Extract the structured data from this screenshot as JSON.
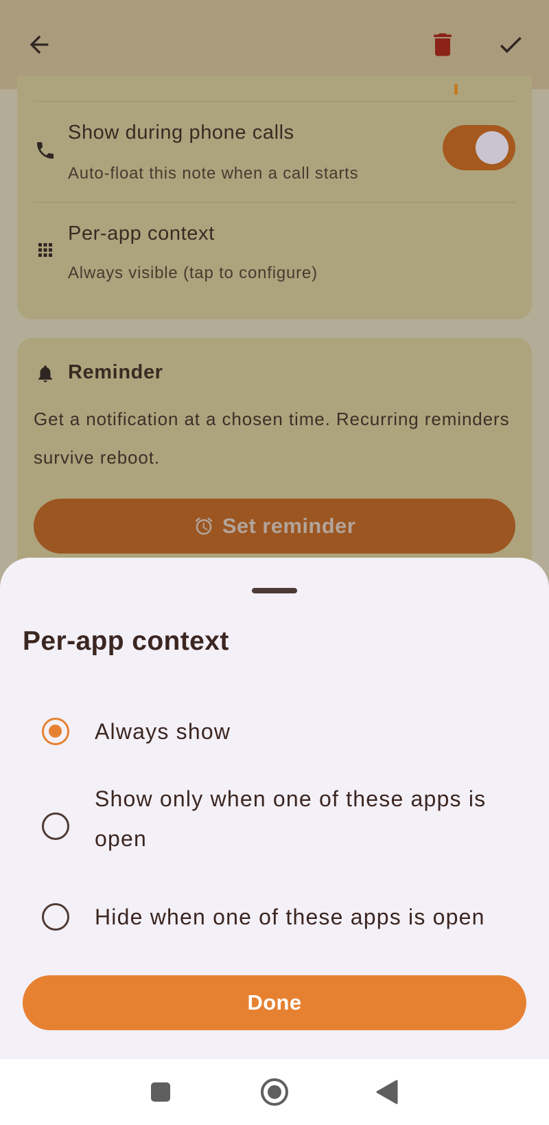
{
  "appbar": {
    "back_icon": "arrow-left-icon",
    "delete_icon": "trash-icon",
    "save_icon": "check-icon"
  },
  "settings_card": {
    "phone_calls": {
      "icon": "phone-icon",
      "title": "Show during phone calls",
      "subtitle": "Auto-float this note when a call starts",
      "toggle_on": true
    },
    "per_app": {
      "icon": "grid-icon",
      "title": "Per-app context",
      "subtitle": "Always visible (tap to configure)"
    }
  },
  "reminder_card": {
    "icon": "bell-icon",
    "title": "Reminder",
    "description": "Get a notification at a chosen time. Recurring reminders survive reboot.",
    "button_icon": "alarm-icon",
    "button_label": "Set reminder"
  },
  "sheet": {
    "title": "Per-app context",
    "options": [
      {
        "label": "Always show",
        "selected": true
      },
      {
        "label": "Show only when one of these apps is open",
        "selected": false
      },
      {
        "label": "Hide when one of these apps is open",
        "selected": false
      }
    ],
    "done_label": "Done"
  },
  "navbar": {
    "items": [
      "recents-icon",
      "home-icon",
      "back-icon"
    ]
  },
  "colors": {
    "accent": "#e68132",
    "toggle_track": "#a5591f",
    "delete": "#8b2318",
    "sheet_bg": "#f4f0f7"
  }
}
